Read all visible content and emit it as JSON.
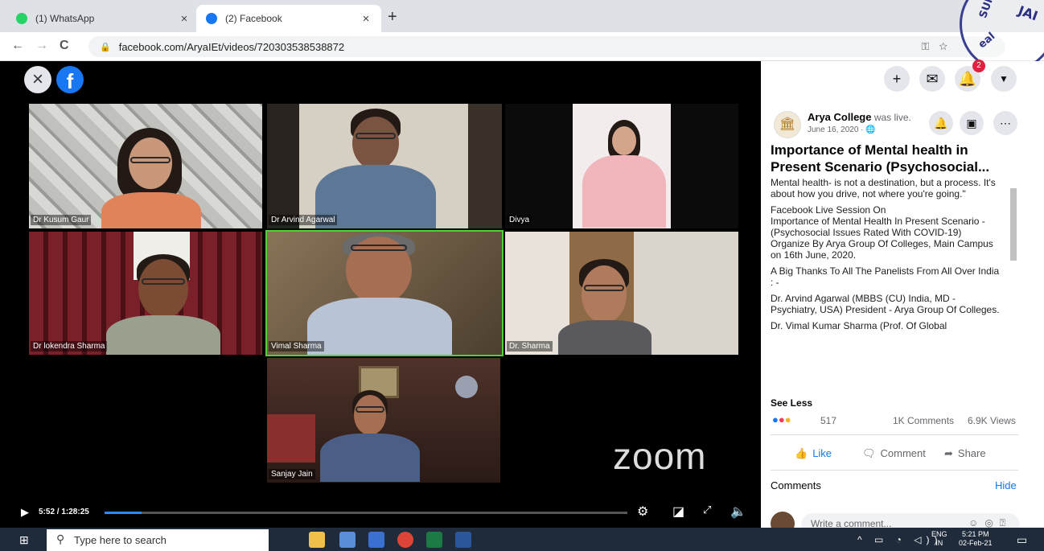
{
  "browser": {
    "tabs": [
      {
        "label": "(1) WhatsApp",
        "close": "×",
        "icon": "whatsapp-icon",
        "color": "#25d366"
      },
      {
        "label": "(2) Facebook",
        "close": "×",
        "icon": "facebook-icon",
        "color": "#1877f2"
      }
    ],
    "new_tab": "+",
    "url": "facebook.com/AryaIEt/videos/720303538538872",
    "nav": {
      "back": "←",
      "forward": "→",
      "reload": "C"
    }
  },
  "stamp": {
    "text_top": "JAI",
    "text_mid": "SUI",
    "text_left": "eal"
  },
  "video": {
    "close": "×",
    "logo": "f",
    "participants": [
      "Dr Kusum Gaur",
      "Dr Arvind Agarwal",
      "Divya",
      "Dr lokendra Sharma",
      "Vimal Sharma",
      "Dr. Sharma",
      "Sanjay Jain"
    ],
    "watermark": "zoom",
    "time": "5:52 / 1:28:25",
    "progress": 0.07
  },
  "panel": {
    "top_icons": [
      "+",
      "messenger-icon",
      "bell-icon",
      "caret-down-icon"
    ],
    "notification_count": "2",
    "page_name": "Arya College",
    "live_text": " was live.",
    "date": "June 16, 2020 · 🌐",
    "title": "Importance of Mental health in Present Scenario (Psychosocial...",
    "description": [
      "Mental health- is not a destination, but a process. It's about how you drive, not where you're going.\"",
      "Facebook Live Session On\nImportance of Mental Health In Present Scenario - (Psychosocial Issues Rated With COVID-19)\nOrganize By Arya Group Of Colleges, Main Campus on 16th June, 2020.",
      "A Big Thanks To All The Panelists From All Over India : -",
      "Dr. Arvind Agarwal (MBBS (CU) India, MD - Psychiatry, USA) President - Arya Group Of Colleges.",
      "Dr. Vimal Kumar Sharma (Prof. Of Global"
    ],
    "see_less": "See Less",
    "reaction_count": "517",
    "comments_count": "1K Comments",
    "views_count": "6.9K Views",
    "actions": {
      "like": "Like",
      "comment": "Comment",
      "share": "Share"
    },
    "comments_header": "Comments",
    "hide": "Hide",
    "comment_placeholder": "Write a comment..."
  },
  "taskbar": {
    "search_placeholder": "Type here to search",
    "lang_top": "ENG",
    "lang_bottom": "IN",
    "time": "5:21 PM",
    "date": "02-Feb-21"
  }
}
